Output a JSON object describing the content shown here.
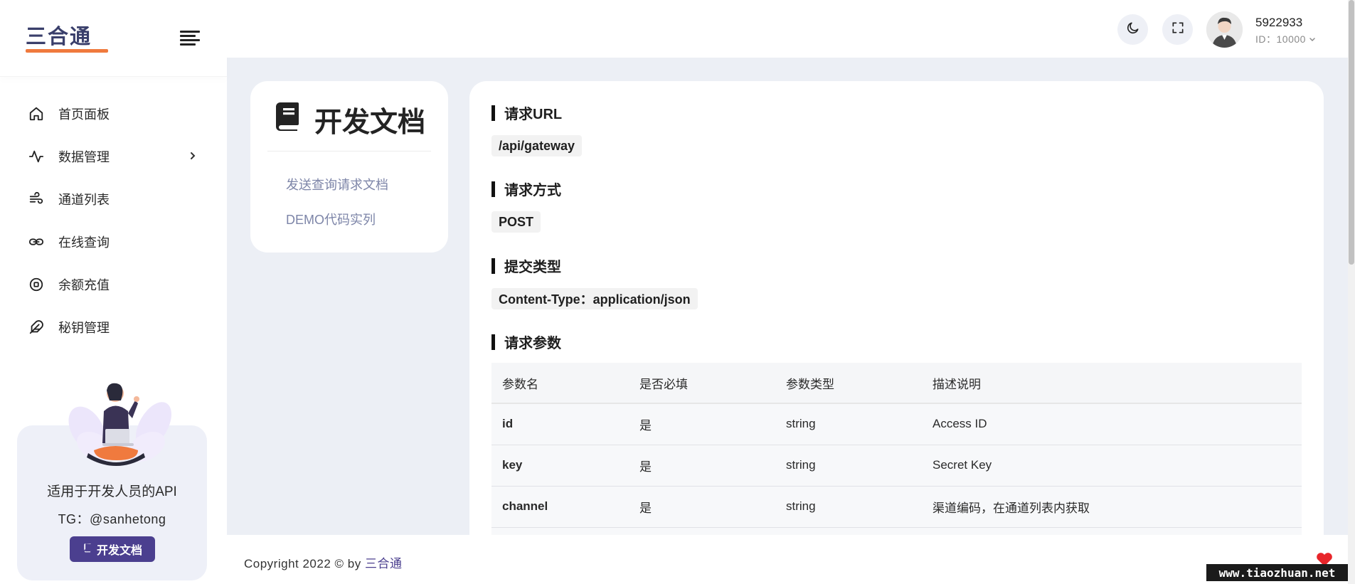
{
  "brand": {
    "logo_text": "三合通",
    "underline_color": "#f07a3e",
    "accent": "#4b3f8f"
  },
  "sidebar": {
    "items": [
      {
        "label": "首页面板",
        "icon": "home-icon"
      },
      {
        "label": "数据管理",
        "icon": "activity-icon",
        "has_submenu": true
      },
      {
        "label": "通道列表",
        "icon": "wind-icon"
      },
      {
        "label": "在线查询",
        "icon": "link-icon"
      },
      {
        "label": "余额充值",
        "icon": "circle-stop-icon"
      },
      {
        "label": "秘钥管理",
        "icon": "feather-icon"
      }
    ],
    "promo": {
      "title": "适用于开发人员的API",
      "tg": "TG：@sanhetong",
      "button_label": "开发文档"
    }
  },
  "header": {
    "user_name": "5922933",
    "user_id": "ID：10000"
  },
  "doc_nav": {
    "title": "开发文档",
    "links": [
      "发送查询请求文档",
      "DEMO代码实列"
    ]
  },
  "content": {
    "sections": [
      {
        "heading": "请求URL",
        "value": "/api/gateway"
      },
      {
        "heading": "请求方式",
        "value": "POST"
      },
      {
        "heading": "提交类型",
        "value": "Content-Type：application/json"
      },
      {
        "heading": "请求参数"
      }
    ],
    "table": {
      "headers": [
        "参数名",
        "是否必填",
        "参数类型",
        "描述说明"
      ],
      "rows": [
        [
          "id",
          "是",
          "string",
          "Access ID"
        ],
        [
          "key",
          "是",
          "string",
          "Secret Key"
        ],
        [
          "channel",
          "是",
          "string",
          "渠道编码，在通道列表内获取"
        ]
      ]
    }
  },
  "footer": {
    "copyright": "Copyright 2022 © by ",
    "brand": "三合通"
  },
  "watermark": "www.tiaozhuan.net"
}
